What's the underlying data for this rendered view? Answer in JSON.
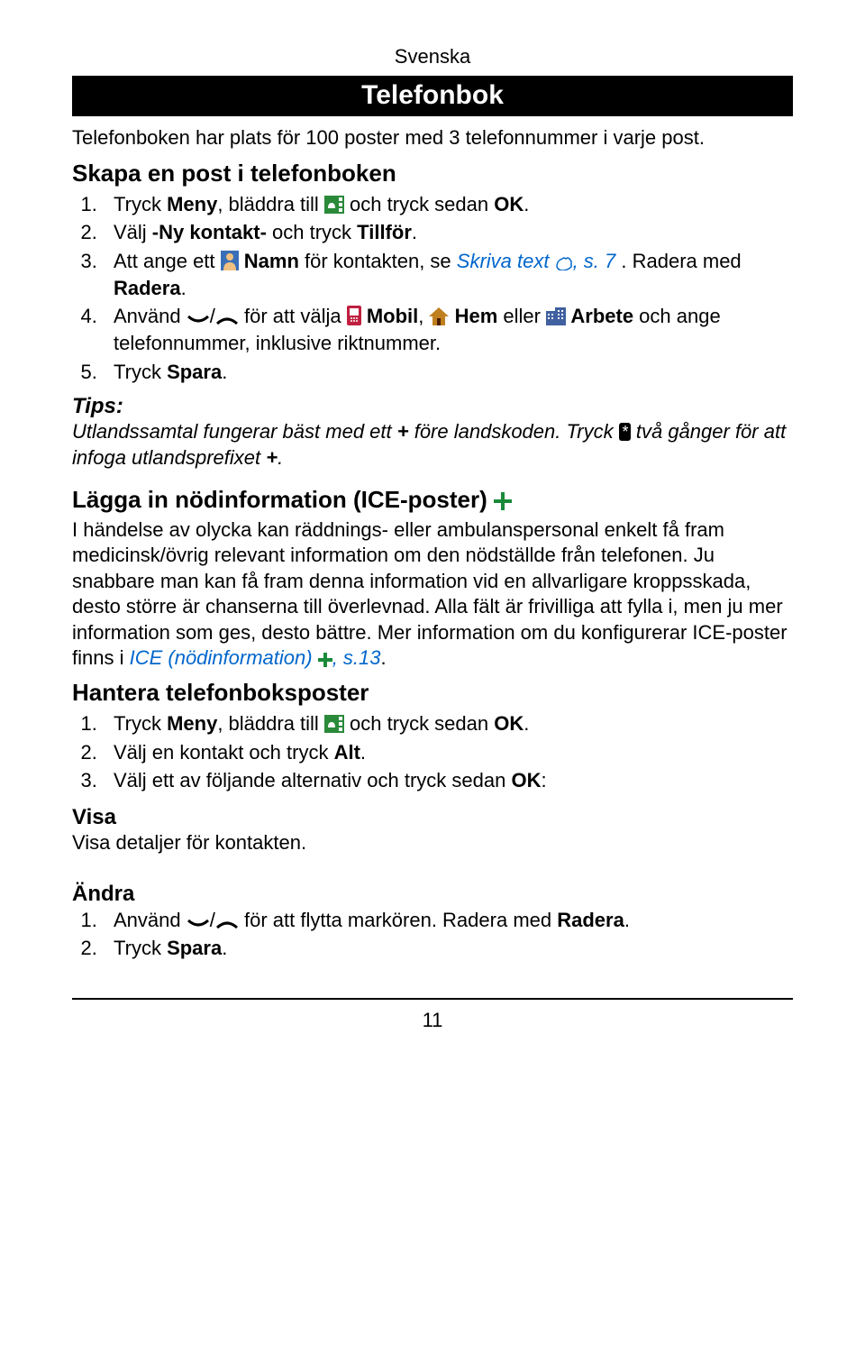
{
  "header_label": "Svenska",
  "title": "Telefonbok",
  "intro": "Telefonboken har plats för 100 poster med 3 telefonnummer i varje post.",
  "section1_heading": "Skapa en post i telefonboken",
  "steps1": {
    "s1a": "Tryck ",
    "s1b": "Meny",
    "s1c": ", bläddra till ",
    "s1d": " och tryck sedan ",
    "s1e": "OK",
    "s1f": ".",
    "s2a": "Välj ",
    "s2b": "-Ny kontakt-",
    "s2c": " och tryck ",
    "s2d": "Tillför",
    "s2e": ".",
    "s3a": "Att ange ett ",
    "s3b": " Namn",
    "s3c": " för kontakten, se ",
    "s3d": "Skriva text ",
    "s3e": ", s. 7",
    "s3f": " . Radera med ",
    "s3g": "Radera",
    "s3h": ".",
    "s4a": "Använd ",
    "s4b": "/",
    "s4c": " för att välja ",
    "s4d": " Mobil",
    "s4e": ", ",
    "s4f": " Hem",
    "s4g": " eller ",
    "s4h": " Arbete",
    "s4i": " och ange telefonnummer, inklusive riktnummer.",
    "s5a": "Tryck ",
    "s5b": "Spara",
    "s5c": "."
  },
  "tips_label": "Tips:",
  "tips_a": "Utlandssamtal fungerar bäst med ett ",
  "tips_plus1": "+",
  "tips_b": " före landskoden. Tryck ",
  "tips_c": " två gånger för att infoga utlandsprefixet ",
  "tips_plus2": "+",
  "tips_d": ".",
  "section2_heading": "Lägga in nödinformation (ICE-poster) ",
  "section2_body_a": "I händelse av olycka kan räddnings- eller ambulanspersonal enkelt få fram medicinsk/övrig relevant information om den nödställde från telefonen. Ju snabbare man kan få fram denna information vid en allvarligare kroppsskada, desto större är chanserna till överlevnad. Alla fält är frivilliga att fylla i, men ju mer information som ges, desto bättre. Mer information om du konfigurerar ICE-poster finns i ",
  "section2_link_a": "ICE (nödinformation) ",
  "section2_link_b": ", s.13",
  "section2_body_b": ".",
  "section3_heading": "Hantera telefonboksposter",
  "steps3": {
    "s1a": "Tryck ",
    "s1b": "Meny",
    "s1c": ", bläddra till ",
    "s1d": " och tryck sedan ",
    "s1e": "OK",
    "s1f": ".",
    "s2a": "Välj en kontakt och tryck ",
    "s2b": "Alt",
    "s2c": ".",
    "s3a": "Välj ett av följande alternativ och tryck sedan ",
    "s3b": "OK",
    "s3c": ":"
  },
  "visa_h": "Visa",
  "visa_body": "Visa detaljer för kontakten.",
  "andra_h": "Ändra",
  "steps4": {
    "s1a": "Använd ",
    "s1b": "/",
    "s1c": " för att flytta markören. Radera med ",
    "s1d": "Radera",
    "s1e": ".",
    "s2a": "Tryck ",
    "s2b": "Spara",
    "s2c": "."
  },
  "page_number": "11",
  "asterisk_key": "*"
}
